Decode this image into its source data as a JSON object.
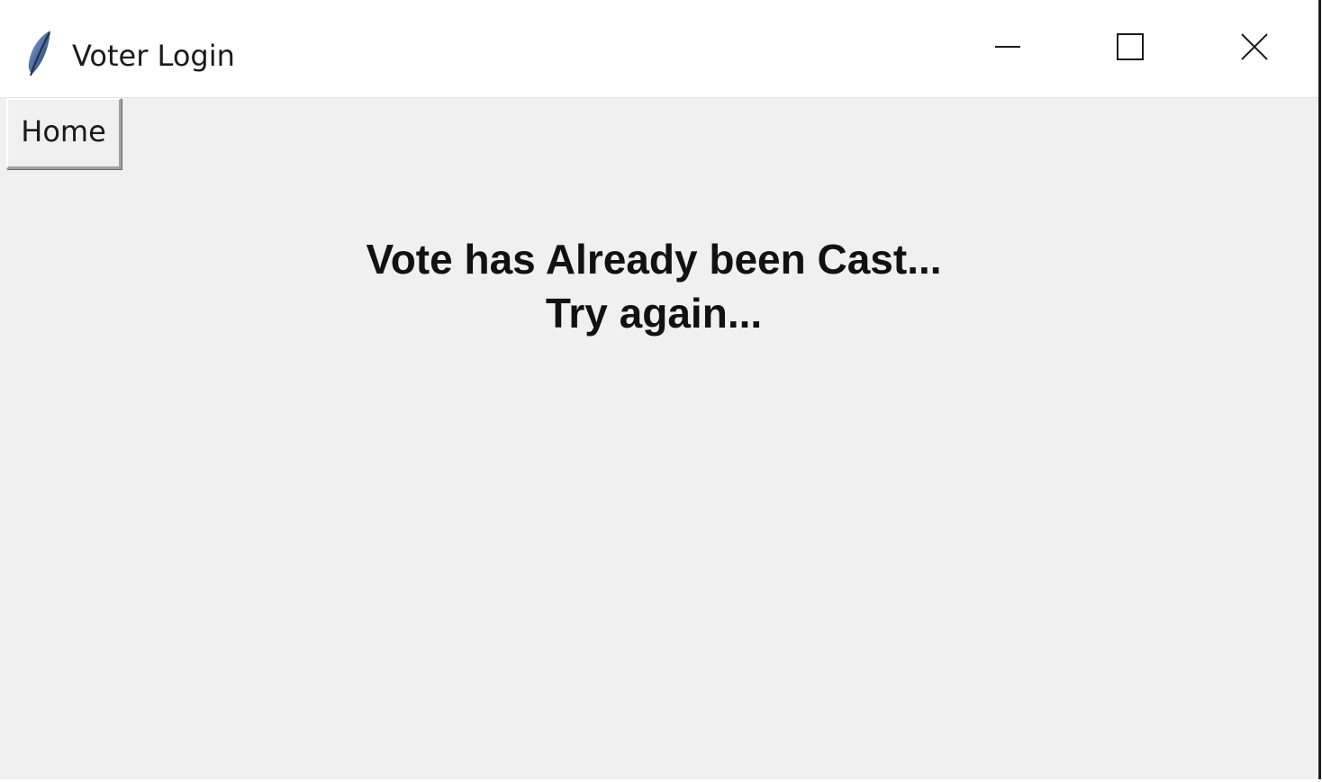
{
  "window": {
    "title": "Voter Login",
    "icon": "feather-icon",
    "controls": {
      "minimize": "minimize-icon",
      "maximize": "maximize-icon",
      "close": "close-icon"
    }
  },
  "toolbar": {
    "home_label": "Home"
  },
  "message": {
    "line1": "Vote has Already been Cast...",
    "line2": "Try again..."
  },
  "colors": {
    "background": "#f0f0f0",
    "titlebar": "#ffffff",
    "text": "#111111"
  }
}
